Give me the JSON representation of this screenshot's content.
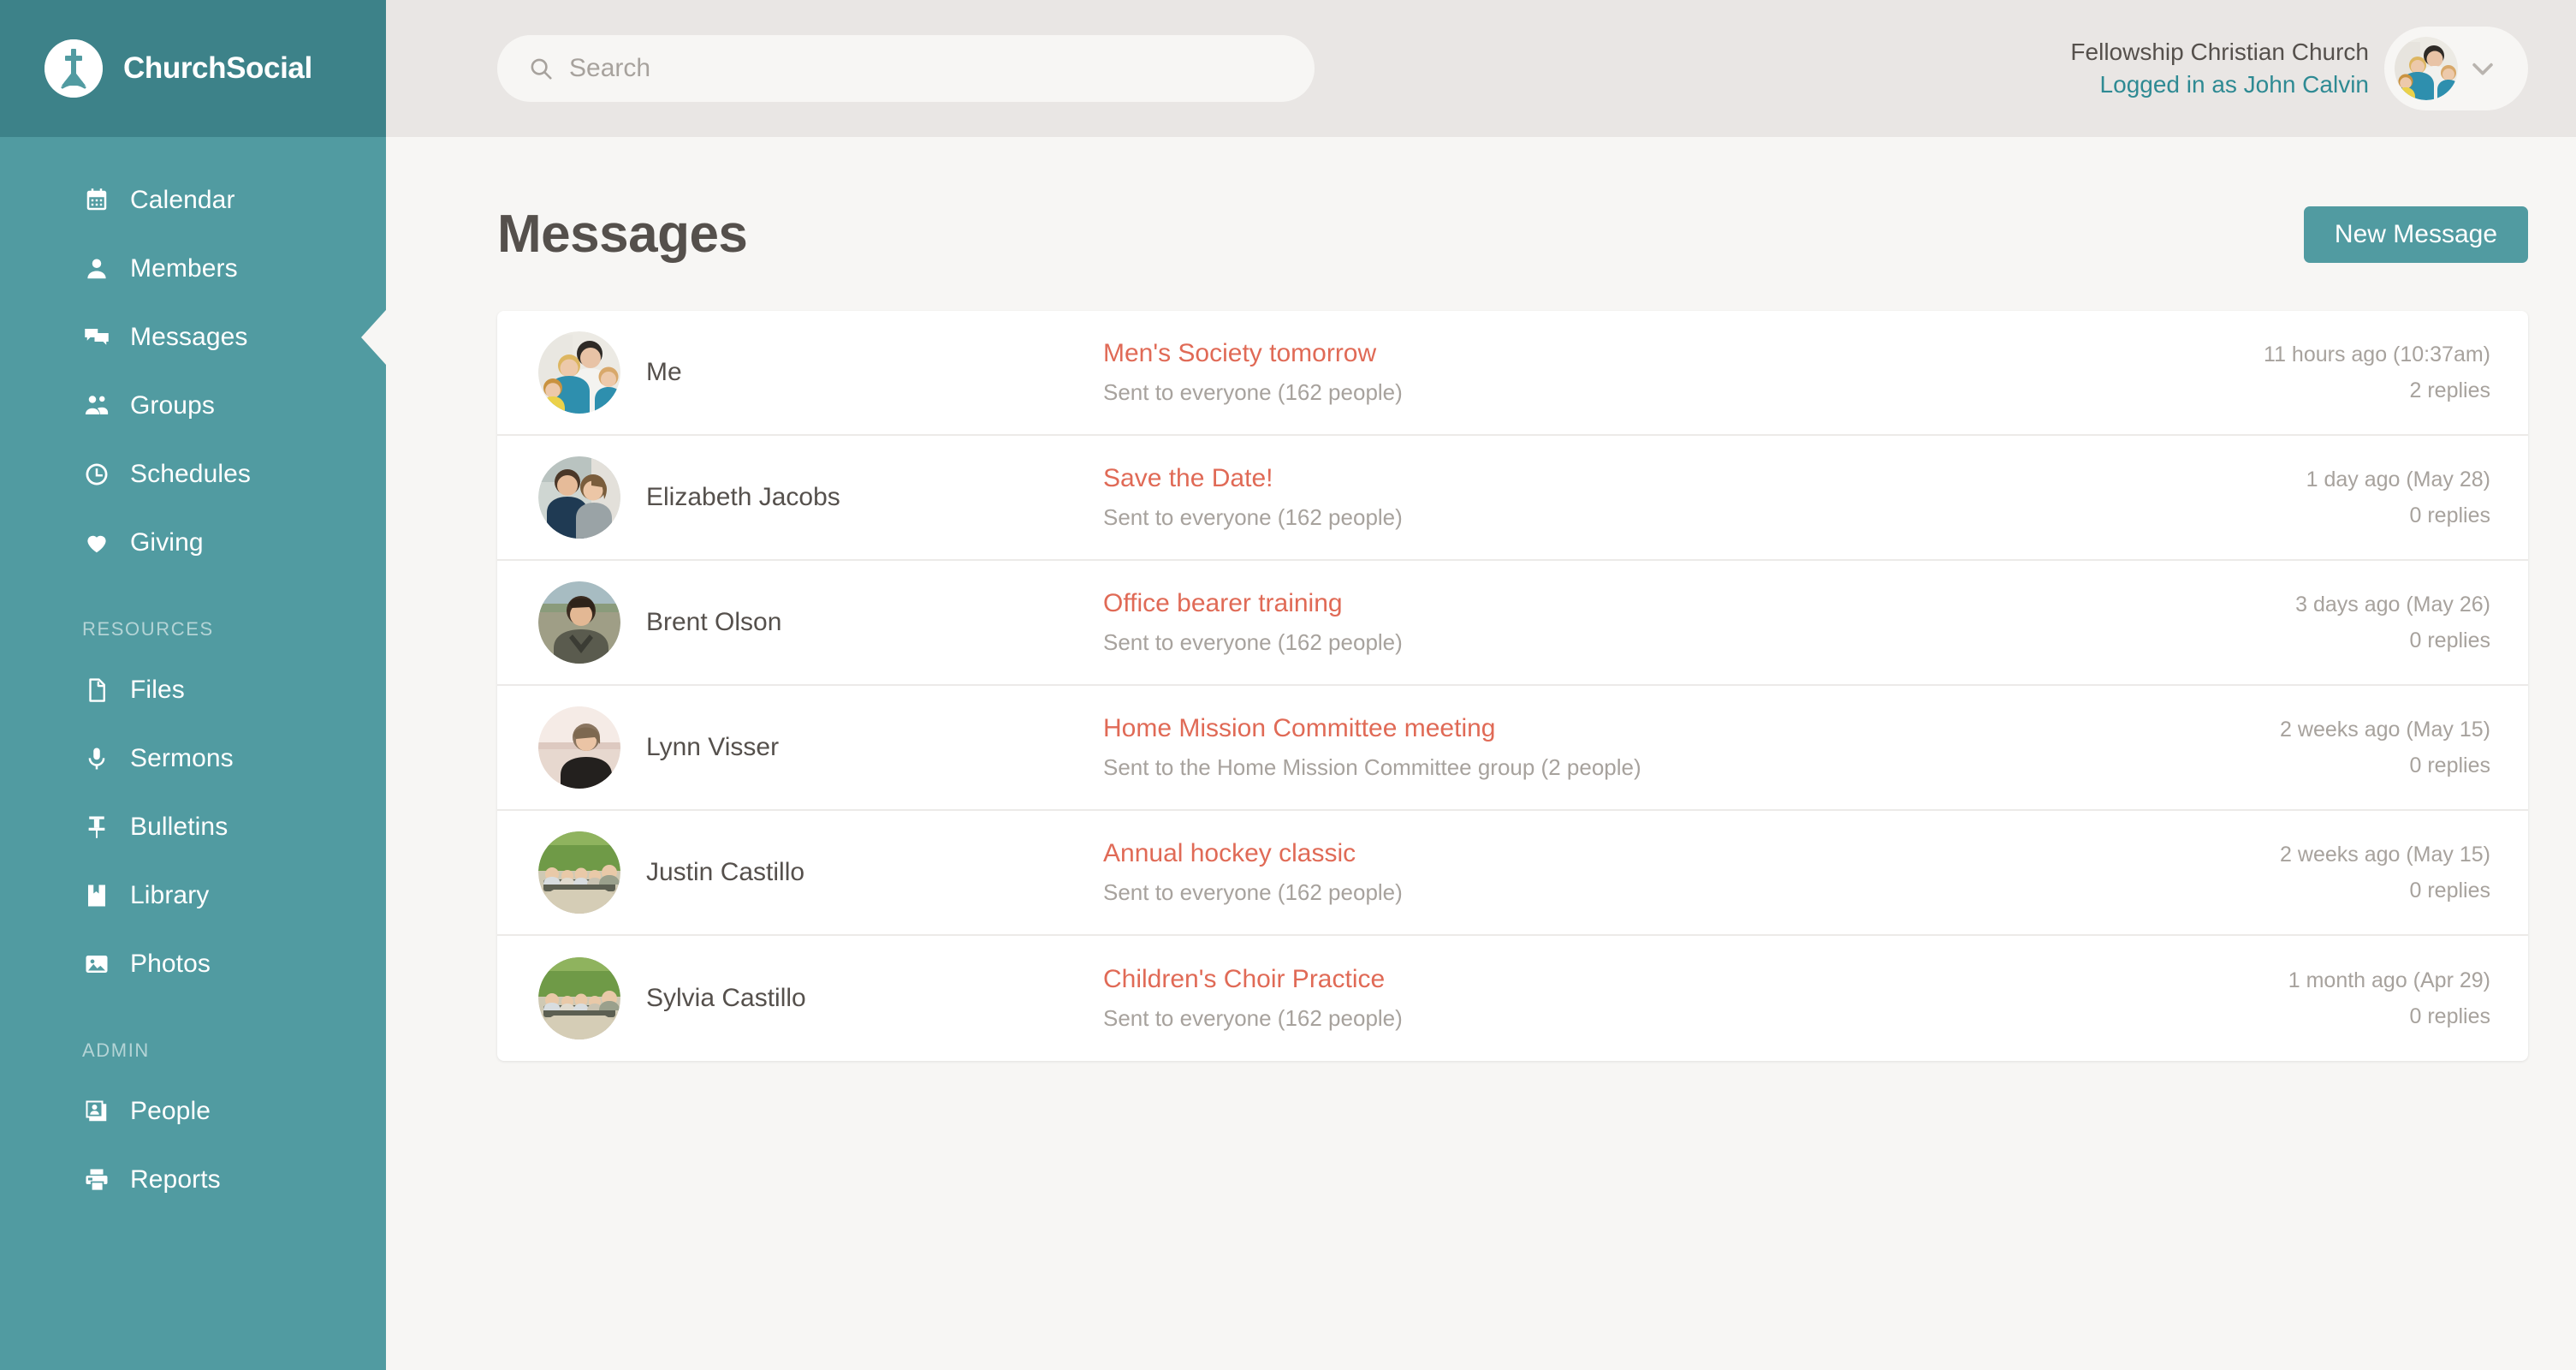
{
  "brand": {
    "name": "ChurchSocial",
    "logo_icon": "church-cross-logo-icon"
  },
  "sidebar": {
    "primary_items": [
      {
        "label": "Calendar",
        "icon": "calendar-icon",
        "active": false
      },
      {
        "label": "Members",
        "icon": "person-icon",
        "active": false
      },
      {
        "label": "Messages",
        "icon": "chat-bubbles-icon",
        "active": true
      },
      {
        "label": "Groups",
        "icon": "people-group-icon",
        "active": false
      },
      {
        "label": "Schedules",
        "icon": "clock-icon",
        "active": false
      },
      {
        "label": "Giving",
        "icon": "heart-icon",
        "active": false
      }
    ],
    "resources_label": "RESOURCES",
    "resources_items": [
      {
        "label": "Files",
        "icon": "file-icon"
      },
      {
        "label": "Sermons",
        "icon": "microphone-icon"
      },
      {
        "label": "Bulletins",
        "icon": "pushpin-icon"
      },
      {
        "label": "Library",
        "icon": "book-icon"
      },
      {
        "label": "Photos",
        "icon": "image-icon"
      }
    ],
    "admin_label": "ADMIN",
    "admin_items": [
      {
        "label": "People",
        "icon": "id-card-icon"
      },
      {
        "label": "Reports",
        "icon": "printer-icon"
      }
    ]
  },
  "topbar": {
    "search_placeholder": "Search",
    "search_value": "",
    "search_icon": "search-icon",
    "church_name": "Fellowship Christian Church",
    "logged_in_as": "Logged in as John Calvin",
    "avatar_icon": "user-avatar",
    "chevron_icon": "chevron-down-icon"
  },
  "page": {
    "title": "Messages",
    "new_message_label": "New Message"
  },
  "messages": [
    {
      "sender": "Me",
      "subject": "Men's Society tomorrow",
      "recipients": "Sent to everyone (162 people)",
      "time": "11 hours ago (10:37am)",
      "replies": "2 replies",
      "avatar": "family-blue"
    },
    {
      "sender": "Elizabeth Jacobs",
      "subject": "Save the Date!",
      "recipients": "Sent to everyone (162 people)",
      "time": "1 day ago (May 28)",
      "replies": "0 replies",
      "avatar": "couple-dark"
    },
    {
      "sender": "Brent Olson",
      "subject": "Office bearer training",
      "recipients": "Sent to everyone (162 people)",
      "time": "3 days ago (May 26)",
      "replies": "0 replies",
      "avatar": "man-outdoor"
    },
    {
      "sender": "Lynn Visser",
      "subject": "Home Mission Committee meeting",
      "recipients": "Sent to the Home Mission Committee group (2 people)",
      "time": "2 weeks ago (May 15)",
      "replies": "0 replies",
      "avatar": "woman-beach"
    },
    {
      "sender": "Justin Castillo",
      "subject": "Annual hockey classic",
      "recipients": "Sent to everyone (162 people)",
      "time": "2 weeks ago (May 15)",
      "replies": "0 replies",
      "avatar": "family-green"
    },
    {
      "sender": "Sylvia Castillo",
      "subject": "Children's Choir Practice",
      "recipients": "Sent to everyone (162 people)",
      "time": "1 month ago (Apr 29)",
      "replies": "0 replies",
      "avatar": "family-green"
    }
  ],
  "colors": {
    "sidebar": "#519ba1",
    "sidebar_brand": "#3d8289",
    "accent": "#519ba1",
    "subject_red": "#e06a56",
    "page_bg": "#f7f6f4",
    "topbar_bg": "#e9e6e4",
    "text_dark": "#55504c",
    "text_muted": "#a7a29d"
  }
}
